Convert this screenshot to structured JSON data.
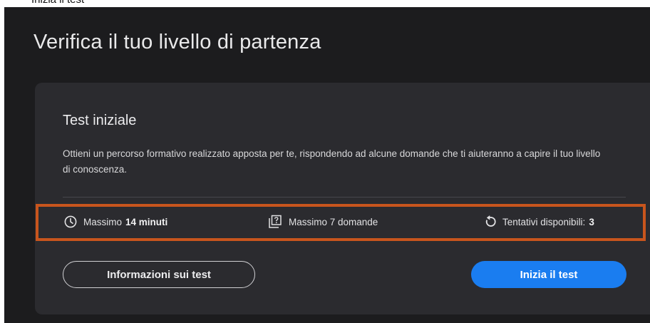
{
  "top_strip": {
    "text": "Inizia il test"
  },
  "page": {
    "title": "Verifica il tuo livello di partenza"
  },
  "card": {
    "title": "Test iniziale",
    "description": "Ottieni un percorso formativo realizzato apposta per te, rispondendo ad alcune domande che ti aiuteranno a capire il tuo livello di conoscenza."
  },
  "meta": {
    "duration": {
      "label": "Massimo",
      "value": "14 minuti",
      "icon": "clock-icon"
    },
    "questions": {
      "label": "Massimo 7 domande",
      "icon": "question-box-icon"
    },
    "attempts": {
      "label": "Tentativi disponibili:",
      "value": "3",
      "icon": "retry-icon"
    }
  },
  "buttons": {
    "info_label": "Informazioni sui test",
    "start_label": "Inizia il test"
  },
  "colors": {
    "background": "#1c1c1e",
    "card": "#2b2b2f",
    "highlight": "#c8551d",
    "primary": "#1a7df0"
  }
}
